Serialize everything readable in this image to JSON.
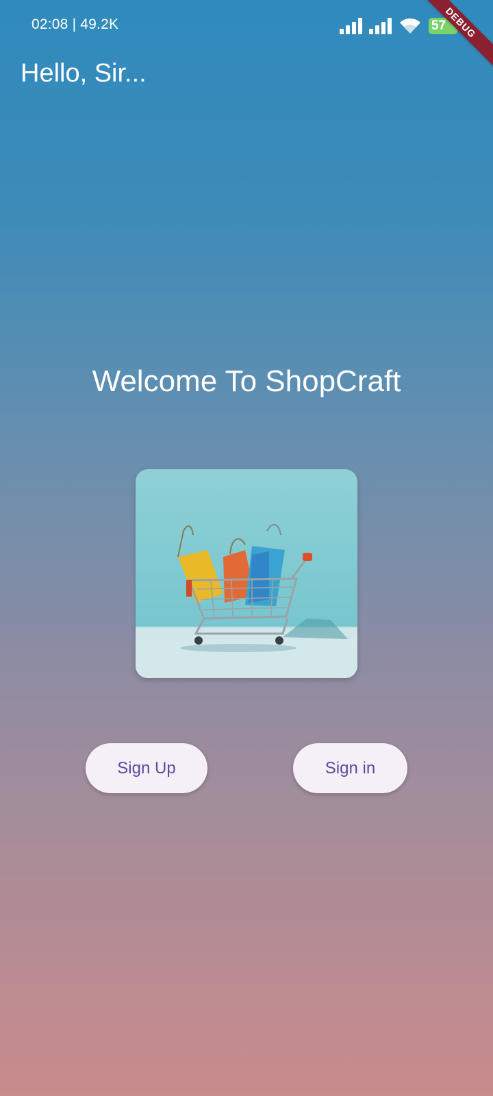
{
  "status_bar": {
    "time_and_speed": "02:08 | 49.2K",
    "battery_level": "57",
    "icons": [
      "signal-icon",
      "signal-icon",
      "wifi-icon",
      "battery-icon"
    ]
  },
  "debug_banner": "DEBUG",
  "header": {
    "greeting": "Hello, Sir..."
  },
  "main": {
    "welcome_title": "Welcome To ShopCraft",
    "hero_image_icon": "shopping-cart-with-bags-image",
    "buttons": {
      "sign_up": "Sign Up",
      "sign_in": "Sign in"
    }
  },
  "colors": {
    "gradient_top": "#2f8bbd",
    "gradient_bottom": "#c98b8c",
    "button_bg": "#f5eff8",
    "button_text": "#5b4a9a",
    "battery": "#7ad269",
    "debug_banner": "#8a2030"
  }
}
